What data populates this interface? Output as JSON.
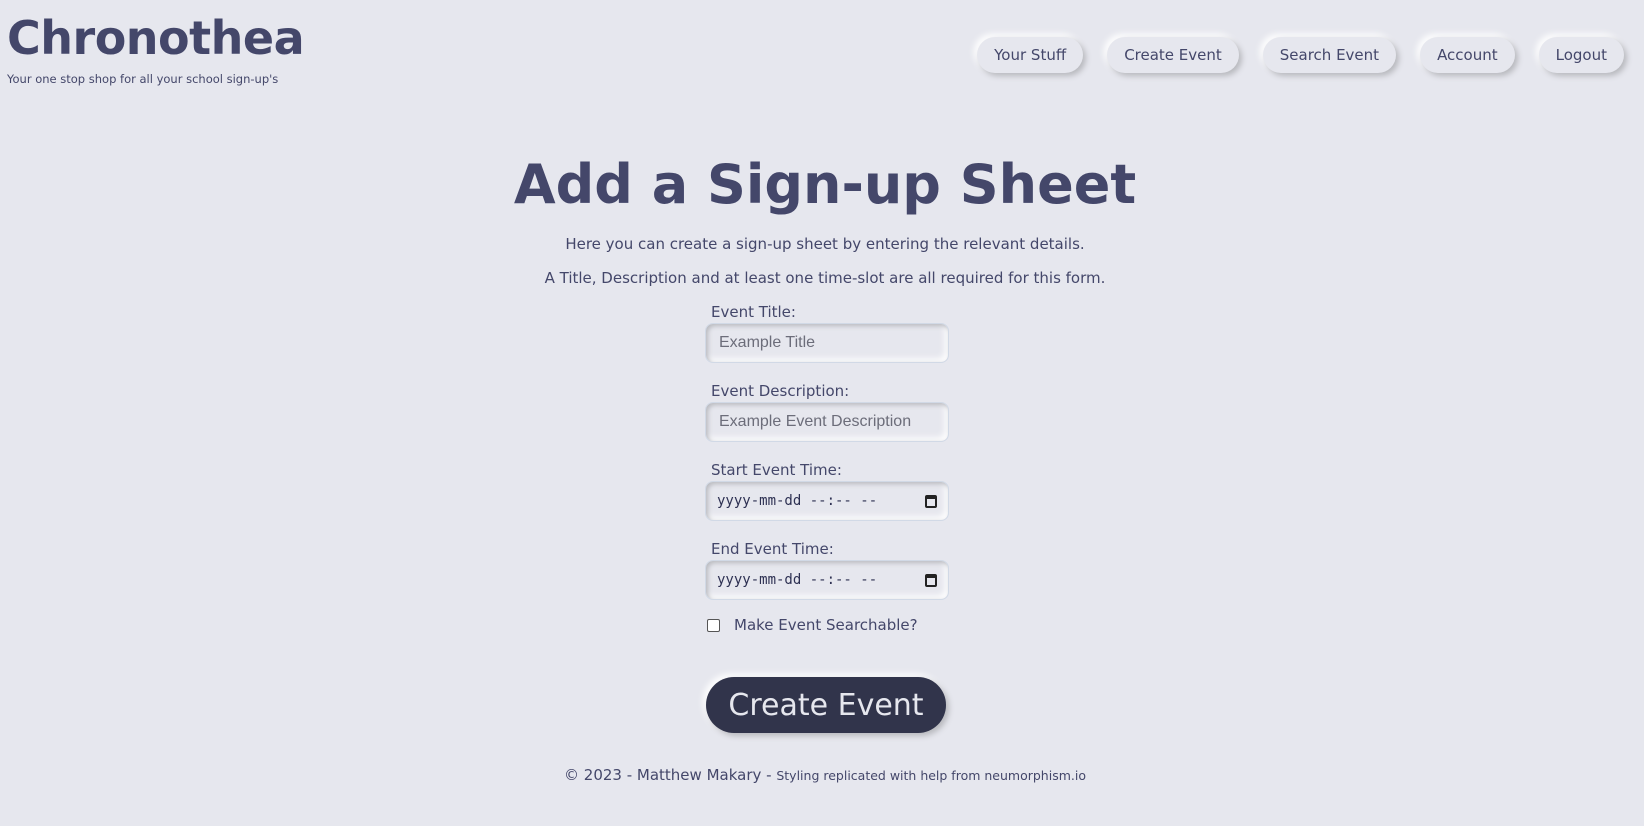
{
  "app": {
    "title": "Chronothea",
    "tagline": "Your one stop shop for all your school sign-up's"
  },
  "nav": {
    "items": [
      {
        "label": "Your Stuff"
      },
      {
        "label": "Create Event"
      },
      {
        "label": "Search Event"
      },
      {
        "label": "Account"
      },
      {
        "label": "Logout"
      }
    ]
  },
  "main": {
    "title": "Add a Sign-up Sheet",
    "intro_1": "Here you can create a sign-up sheet by entering the relevant details.",
    "intro_2": "A Title, Description and at least one time-slot are all required for this form."
  },
  "form": {
    "title_label": "Event Title:",
    "title_placeholder": "Example Title",
    "description_label": "Event Description:",
    "description_placeholder": "Example Event Description",
    "start_label": "Start Event Time:",
    "start_value": "yyyy-mm-dd --:-- --",
    "end_label": "End Event Time:",
    "end_value": "yyyy-mm-dd --:-- --",
    "searchable_label": "Make Event Searchable?",
    "searchable_checked": false,
    "submit_label": "Create Event",
    "calendar_icon": "calendar-icon"
  },
  "footer": {
    "main_text": "© 2023 - Matthew Makary -",
    "credit_text": "Styling replicated with help from neumorphism.io"
  },
  "colors": {
    "background": "#e6e7ee",
    "text": "#44476a",
    "button_dark": "#31344b"
  }
}
